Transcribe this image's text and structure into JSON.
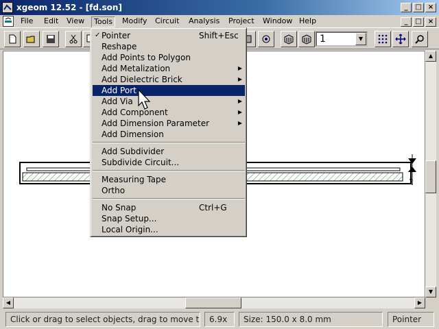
{
  "window": {
    "title": "xgeom 12.52 - [fd.son]",
    "buttons": [
      "_",
      "□",
      "×"
    ]
  },
  "menubar": {
    "items": [
      "File",
      "Edit",
      "View",
      "Tools",
      "Modify",
      "Circuit",
      "Analysis",
      "Project",
      "Window",
      "Help"
    ],
    "active": "Tools"
  },
  "toolbar": {
    "level_value": "1"
  },
  "tools_menu": {
    "groups": [
      [
        {
          "label": "Pointer",
          "shortcut": "Shift+Esc",
          "checked": true
        },
        {
          "label": "Reshape"
        },
        {
          "label": "Add Points to Polygon"
        },
        {
          "label": "Add Metalization",
          "submenu": true
        },
        {
          "label": "Add Dielectric Brick",
          "submenu": true
        },
        {
          "label": "Add Port",
          "highlighted": true
        },
        {
          "label": "Add Via",
          "submenu": true
        },
        {
          "label": "Add Component",
          "submenu": true
        },
        {
          "label": "Add Dimension Parameter",
          "submenu": true
        },
        {
          "label": "Add Dimension"
        }
      ],
      [
        {
          "label": "Add Subdivider"
        },
        {
          "label": "Subdivide Circuit..."
        }
      ],
      [
        {
          "label": "Measuring Tape"
        },
        {
          "label": "Ortho"
        }
      ],
      [
        {
          "label": "No Snap",
          "shortcut": "Ctrl+G"
        },
        {
          "label": "Snap Setup..."
        },
        {
          "label": "Local Origin..."
        }
      ]
    ]
  },
  "canvas": {
    "port_label": "2"
  },
  "statusbar": {
    "hint": "Click or drag to select objects, drag to move them",
    "zoom": "6.9x",
    "size": "Size: 150.0 x 8.0 mm",
    "mode": "Pointer"
  },
  "colors": {
    "title_start": "#0a246a",
    "title_end": "#a6caf0",
    "highlight": "#0a246a",
    "face": "#d4d0c8"
  }
}
